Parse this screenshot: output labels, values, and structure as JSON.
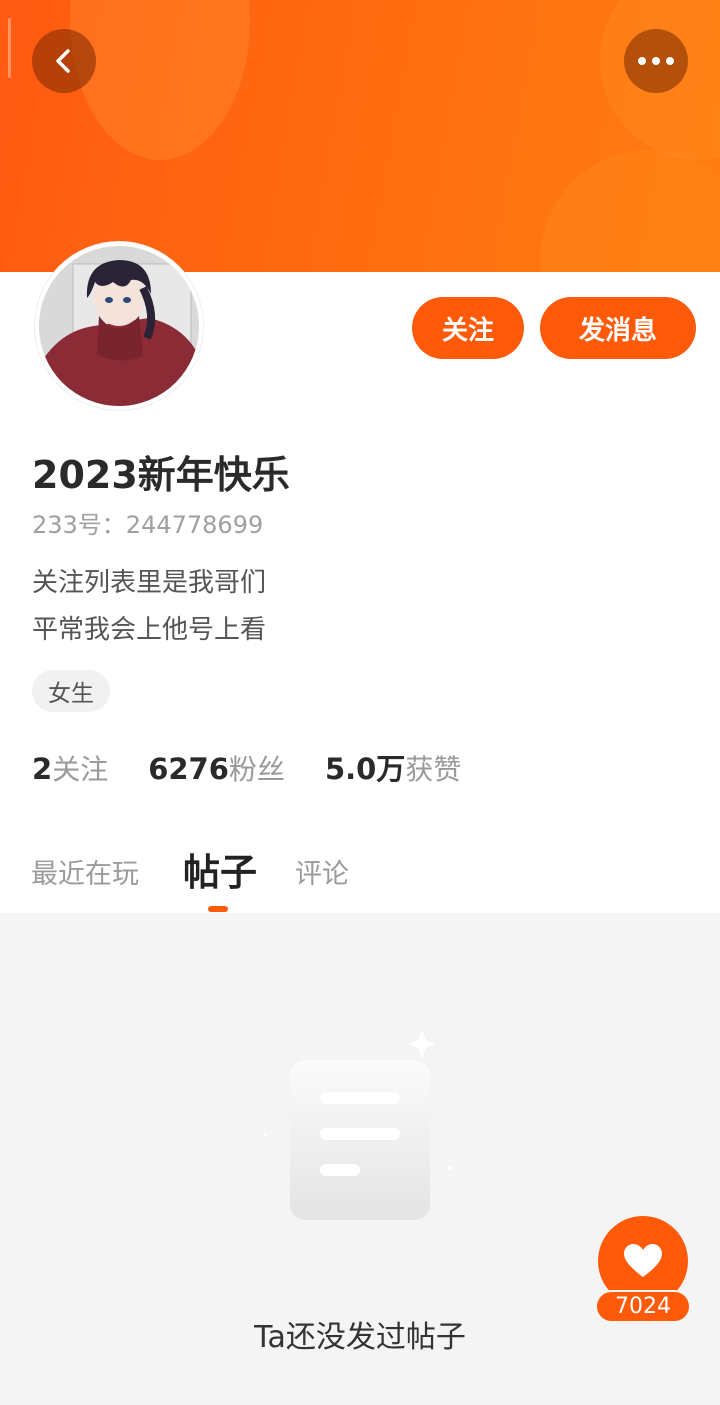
{
  "header": {
    "back_icon": "chevron-left-icon",
    "more_icon": "more-horizontal-icon"
  },
  "actions": {
    "follow_label": "关注",
    "message_label": "发消息"
  },
  "profile": {
    "name": "2023新年快乐",
    "uid": "233号：244778699",
    "bio_line1": "关注列表里是我哥们",
    "bio_line2": "平常我会上他号上看",
    "gender_tag": "女生"
  },
  "stats": {
    "following_count": "2",
    "following_label": "关注",
    "followers_count": "6276",
    "followers_label": "粉丝",
    "likes_count": "5.0万",
    "likes_label": "获赞"
  },
  "tabs": {
    "recent": "最近在玩",
    "posts": "帖子",
    "comments": "评论",
    "active": "posts"
  },
  "empty_state": {
    "message": "Ta还没发过帖子"
  },
  "like_fab": {
    "count": "7024"
  },
  "colors": {
    "accent": "#ff5a0a",
    "banner_start": "#ff5a12",
    "banner_end": "#ff7d12"
  }
}
